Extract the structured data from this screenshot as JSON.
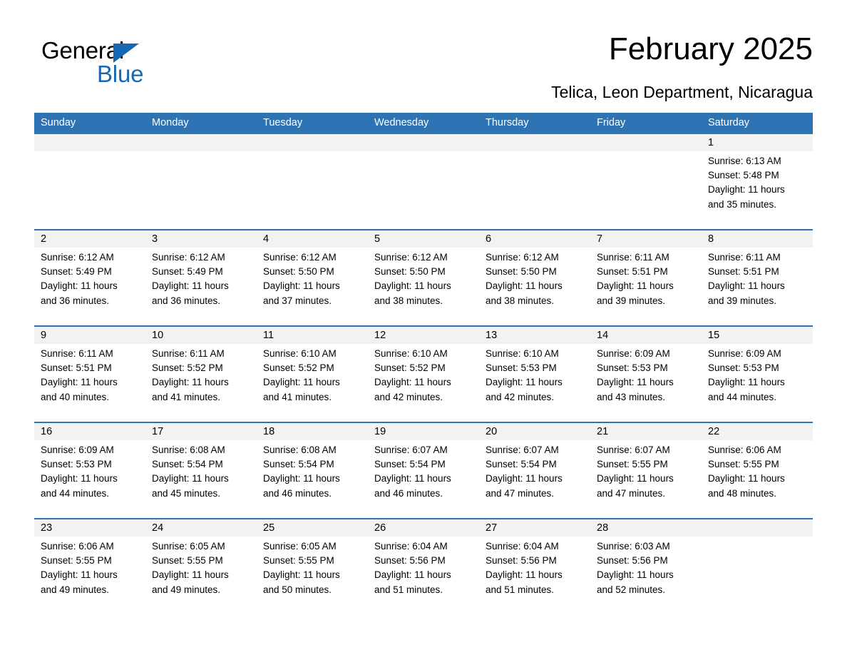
{
  "brand": {
    "word_one": "General",
    "word_two": "Blue",
    "triangle_color": "#1668b3",
    "accent_color": "#2e74b5"
  },
  "header": {
    "title": "February 2025",
    "subtitle": "Telica, Leon Department, Nicaragua"
  },
  "weekdays": [
    "Sunday",
    "Monday",
    "Tuesday",
    "Wednesday",
    "Thursday",
    "Friday",
    "Saturday"
  ],
  "weeks": [
    [
      {
        "day": "",
        "sunrise": "",
        "sunset": "",
        "daylight_line1": "",
        "daylight_line2": ""
      },
      {
        "day": "",
        "sunrise": "",
        "sunset": "",
        "daylight_line1": "",
        "daylight_line2": ""
      },
      {
        "day": "",
        "sunrise": "",
        "sunset": "",
        "daylight_line1": "",
        "daylight_line2": ""
      },
      {
        "day": "",
        "sunrise": "",
        "sunset": "",
        "daylight_line1": "",
        "daylight_line2": ""
      },
      {
        "day": "",
        "sunrise": "",
        "sunset": "",
        "daylight_line1": "",
        "daylight_line2": ""
      },
      {
        "day": "",
        "sunrise": "",
        "sunset": "",
        "daylight_line1": "",
        "daylight_line2": ""
      },
      {
        "day": "1",
        "sunrise": "Sunrise: 6:13 AM",
        "sunset": "Sunset: 5:48 PM",
        "daylight_line1": "Daylight: 11 hours",
        "daylight_line2": "and 35 minutes."
      }
    ],
    [
      {
        "day": "2",
        "sunrise": "Sunrise: 6:12 AM",
        "sunset": "Sunset: 5:49 PM",
        "daylight_line1": "Daylight: 11 hours",
        "daylight_line2": "and 36 minutes."
      },
      {
        "day": "3",
        "sunrise": "Sunrise: 6:12 AM",
        "sunset": "Sunset: 5:49 PM",
        "daylight_line1": "Daylight: 11 hours",
        "daylight_line2": "and 36 minutes."
      },
      {
        "day": "4",
        "sunrise": "Sunrise: 6:12 AM",
        "sunset": "Sunset: 5:50 PM",
        "daylight_line1": "Daylight: 11 hours",
        "daylight_line2": "and 37 minutes."
      },
      {
        "day": "5",
        "sunrise": "Sunrise: 6:12 AM",
        "sunset": "Sunset: 5:50 PM",
        "daylight_line1": "Daylight: 11 hours",
        "daylight_line2": "and 38 minutes."
      },
      {
        "day": "6",
        "sunrise": "Sunrise: 6:12 AM",
        "sunset": "Sunset: 5:50 PM",
        "daylight_line1": "Daylight: 11 hours",
        "daylight_line2": "and 38 minutes."
      },
      {
        "day": "7",
        "sunrise": "Sunrise: 6:11 AM",
        "sunset": "Sunset: 5:51 PM",
        "daylight_line1": "Daylight: 11 hours",
        "daylight_line2": "and 39 minutes."
      },
      {
        "day": "8",
        "sunrise": "Sunrise: 6:11 AM",
        "sunset": "Sunset: 5:51 PM",
        "daylight_line1": "Daylight: 11 hours",
        "daylight_line2": "and 39 minutes."
      }
    ],
    [
      {
        "day": "9",
        "sunrise": "Sunrise: 6:11 AM",
        "sunset": "Sunset: 5:51 PM",
        "daylight_line1": "Daylight: 11 hours",
        "daylight_line2": "and 40 minutes."
      },
      {
        "day": "10",
        "sunrise": "Sunrise: 6:11 AM",
        "sunset": "Sunset: 5:52 PM",
        "daylight_line1": "Daylight: 11 hours",
        "daylight_line2": "and 41 minutes."
      },
      {
        "day": "11",
        "sunrise": "Sunrise: 6:10 AM",
        "sunset": "Sunset: 5:52 PM",
        "daylight_line1": "Daylight: 11 hours",
        "daylight_line2": "and 41 minutes."
      },
      {
        "day": "12",
        "sunrise": "Sunrise: 6:10 AM",
        "sunset": "Sunset: 5:52 PM",
        "daylight_line1": "Daylight: 11 hours",
        "daylight_line2": "and 42 minutes."
      },
      {
        "day": "13",
        "sunrise": "Sunrise: 6:10 AM",
        "sunset": "Sunset: 5:53 PM",
        "daylight_line1": "Daylight: 11 hours",
        "daylight_line2": "and 42 minutes."
      },
      {
        "day": "14",
        "sunrise": "Sunrise: 6:09 AM",
        "sunset": "Sunset: 5:53 PM",
        "daylight_line1": "Daylight: 11 hours",
        "daylight_line2": "and 43 minutes."
      },
      {
        "day": "15",
        "sunrise": "Sunrise: 6:09 AM",
        "sunset": "Sunset: 5:53 PM",
        "daylight_line1": "Daylight: 11 hours",
        "daylight_line2": "and 44 minutes."
      }
    ],
    [
      {
        "day": "16",
        "sunrise": "Sunrise: 6:09 AM",
        "sunset": "Sunset: 5:53 PM",
        "daylight_line1": "Daylight: 11 hours",
        "daylight_line2": "and 44 minutes."
      },
      {
        "day": "17",
        "sunrise": "Sunrise: 6:08 AM",
        "sunset": "Sunset: 5:54 PM",
        "daylight_line1": "Daylight: 11 hours",
        "daylight_line2": "and 45 minutes."
      },
      {
        "day": "18",
        "sunrise": "Sunrise: 6:08 AM",
        "sunset": "Sunset: 5:54 PM",
        "daylight_line1": "Daylight: 11 hours",
        "daylight_line2": "and 46 minutes."
      },
      {
        "day": "19",
        "sunrise": "Sunrise: 6:07 AM",
        "sunset": "Sunset: 5:54 PM",
        "daylight_line1": "Daylight: 11 hours",
        "daylight_line2": "and 46 minutes."
      },
      {
        "day": "20",
        "sunrise": "Sunrise: 6:07 AM",
        "sunset": "Sunset: 5:54 PM",
        "daylight_line1": "Daylight: 11 hours",
        "daylight_line2": "and 47 minutes."
      },
      {
        "day": "21",
        "sunrise": "Sunrise: 6:07 AM",
        "sunset": "Sunset: 5:55 PM",
        "daylight_line1": "Daylight: 11 hours",
        "daylight_line2": "and 47 minutes."
      },
      {
        "day": "22",
        "sunrise": "Sunrise: 6:06 AM",
        "sunset": "Sunset: 5:55 PM",
        "daylight_line1": "Daylight: 11 hours",
        "daylight_line2": "and 48 minutes."
      }
    ],
    [
      {
        "day": "23",
        "sunrise": "Sunrise: 6:06 AM",
        "sunset": "Sunset: 5:55 PM",
        "daylight_line1": "Daylight: 11 hours",
        "daylight_line2": "and 49 minutes."
      },
      {
        "day": "24",
        "sunrise": "Sunrise: 6:05 AM",
        "sunset": "Sunset: 5:55 PM",
        "daylight_line1": "Daylight: 11 hours",
        "daylight_line2": "and 49 minutes."
      },
      {
        "day": "25",
        "sunrise": "Sunrise: 6:05 AM",
        "sunset": "Sunset: 5:55 PM",
        "daylight_line1": "Daylight: 11 hours",
        "daylight_line2": "and 50 minutes."
      },
      {
        "day": "26",
        "sunrise": "Sunrise: 6:04 AM",
        "sunset": "Sunset: 5:56 PM",
        "daylight_line1": "Daylight: 11 hours",
        "daylight_line2": "and 51 minutes."
      },
      {
        "day": "27",
        "sunrise": "Sunrise: 6:04 AM",
        "sunset": "Sunset: 5:56 PM",
        "daylight_line1": "Daylight: 11 hours",
        "daylight_line2": "and 51 minutes."
      },
      {
        "day": "28",
        "sunrise": "Sunrise: 6:03 AM",
        "sunset": "Sunset: 5:56 PM",
        "daylight_line1": "Daylight: 11 hours",
        "daylight_line2": "and 52 minutes."
      },
      {
        "day": "",
        "sunrise": "",
        "sunset": "",
        "daylight_line1": "",
        "daylight_line2": ""
      }
    ]
  ]
}
